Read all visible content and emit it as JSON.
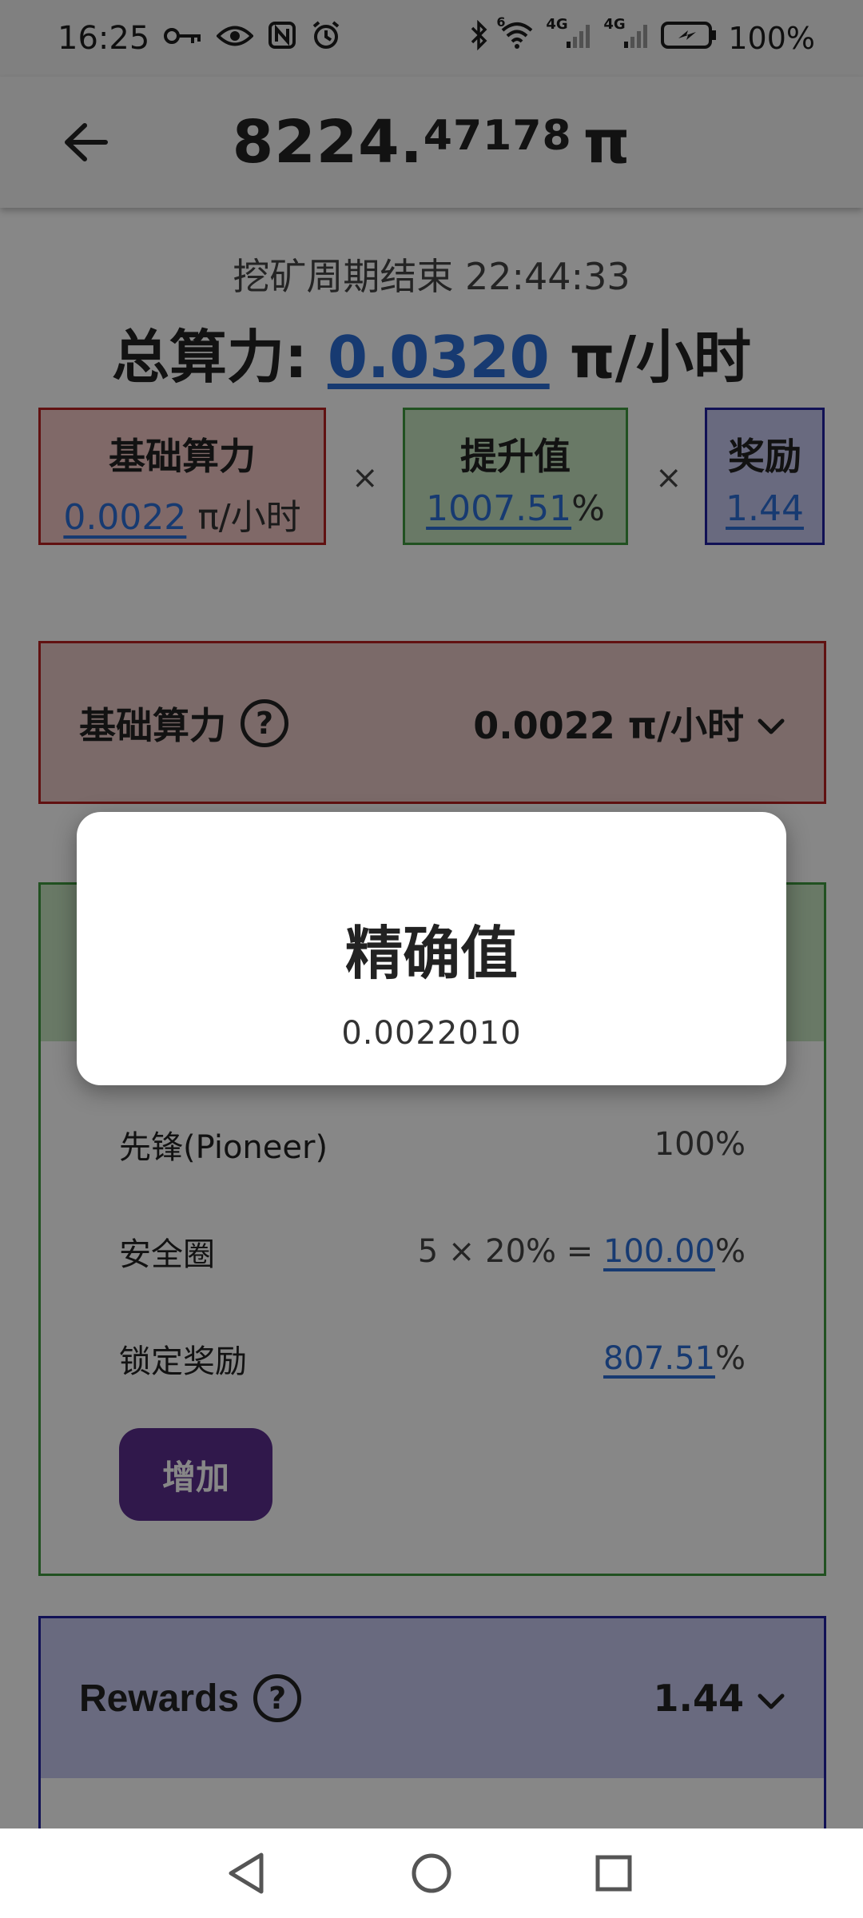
{
  "status_bar": {
    "time": "16:25",
    "battery": "100%",
    "signal_1": "4G",
    "signal_2": "4G",
    "wifi_badge": "6",
    "icons_left": [
      "key-icon",
      "eye-icon",
      "nfc-icon",
      "alarm-icon"
    ],
    "icons_right": [
      "bluetooth-icon",
      "wifi-icon",
      "signal-icon",
      "battery-icon"
    ]
  },
  "app_bar": {
    "balance_int": "8224.",
    "balance_dec": "47178",
    "currency": "π"
  },
  "mining": {
    "cycle_label": "挖矿周期结束 22:44:33",
    "total_label": "总算力:",
    "total_value": "0.0320",
    "total_unit": "π/小时"
  },
  "formula": {
    "base_title": "基础算力",
    "base_value": "0.0022",
    "base_unit": "π/小时",
    "op_multiply": "×",
    "boost_title": "提升值",
    "boost_value": "1007.51",
    "boost_unit": "%",
    "reward_title": "奖励",
    "reward_value": "1.44"
  },
  "base_section": {
    "title": "基础算力",
    "help": "?",
    "value": "0.0022 π/小时"
  },
  "boost_section": {
    "rows": [
      {
        "label": "先锋(Pioneer)",
        "value": "100%"
      },
      {
        "label": "安全圈",
        "prefix": "5 × 20% = ",
        "value": "100.00",
        "unit": "%"
      },
      {
        "label": "锁定奖励",
        "value": "807.51",
        "unit": "%"
      }
    ],
    "add_button": "增加"
  },
  "rewards_section": {
    "title": "Rewards",
    "help": "?",
    "value": "1.44"
  },
  "dialog": {
    "title": "精确值",
    "value": "0.0022010"
  },
  "colors": {
    "link": "#2d6fd6",
    "base_border": "#b72020",
    "boost_border": "#3f9a3f",
    "reward_border": "#2020a0",
    "button": "#5b2e8e"
  }
}
